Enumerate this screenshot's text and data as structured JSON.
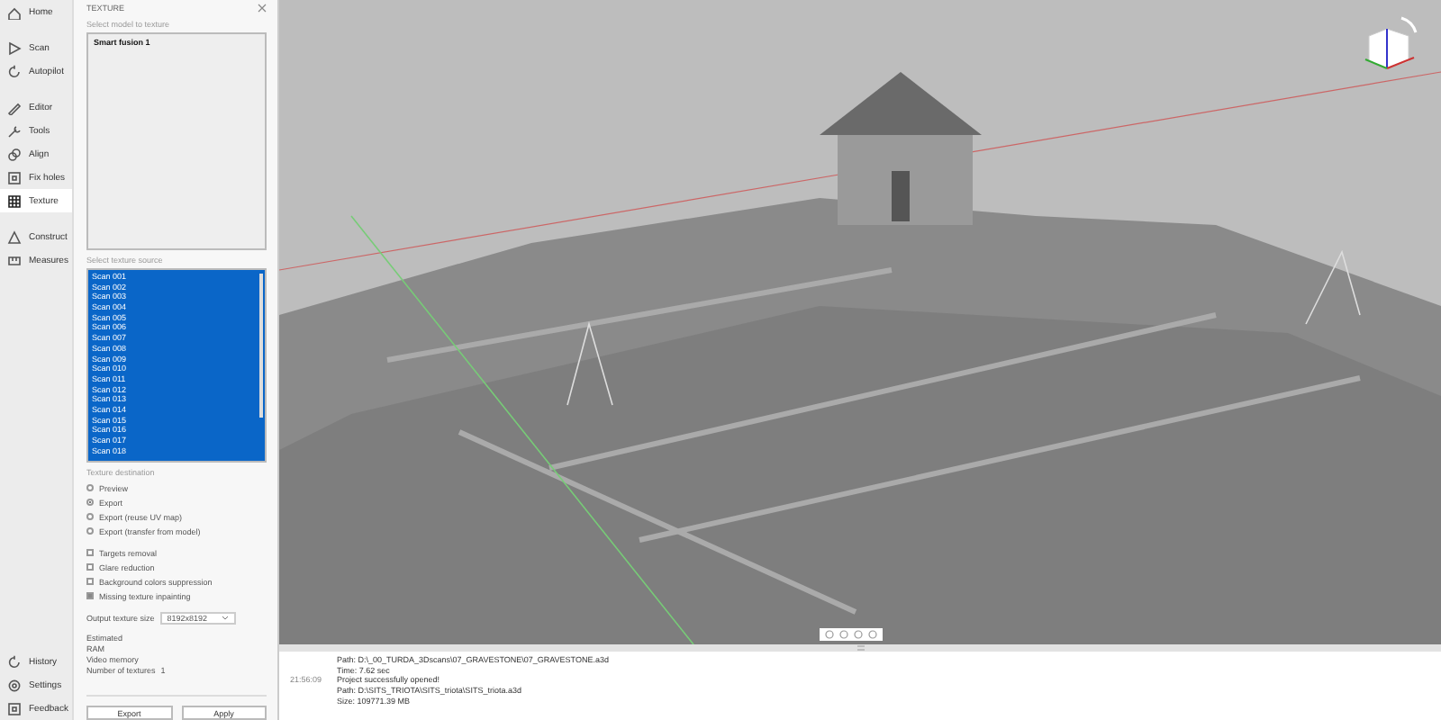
{
  "nav": {
    "top": [
      {
        "label": "Home",
        "kind": "home",
        "selected": false
      },
      {
        "label": "Scan",
        "kind": "play",
        "selected": false
      },
      {
        "label": "Autopilot",
        "kind": "cycle",
        "selected": false
      },
      {
        "label": "Editor",
        "kind": "pen",
        "selected": false
      },
      {
        "label": "Tools",
        "kind": "tool",
        "selected": false
      },
      {
        "label": "Align",
        "kind": "align",
        "selected": false
      },
      {
        "label": "Fix holes",
        "kind": "square",
        "selected": false
      },
      {
        "label": "Texture",
        "kind": "grid",
        "selected": true
      },
      {
        "label": "Construct",
        "kind": "triangle",
        "selected": false
      },
      {
        "label": "Measures",
        "kind": "ruler",
        "selected": false
      }
    ],
    "bottom": [
      {
        "label": "History",
        "kind": "cycle",
        "selected": false
      },
      {
        "label": "Settings",
        "kind": "gear",
        "selected": false
      },
      {
        "label": "Feedback",
        "kind": "square",
        "selected": false
      }
    ]
  },
  "panel": {
    "title": "TEXTURE",
    "model_label": "Select model to texture",
    "models": [
      {
        "label": "Smart fusion 1",
        "selected": false
      }
    ],
    "source_label": "Select texture source",
    "sources": [
      {
        "label": "Scan 001",
        "selected": true
      },
      {
        "label": "Scan 002",
        "selected": true
      },
      {
        "label": "Scan 003",
        "selected": true
      },
      {
        "label": "Scan 004",
        "selected": true
      },
      {
        "label": "Scan 005",
        "selected": true
      },
      {
        "label": "Scan 006",
        "selected": true
      },
      {
        "label": "Scan 007",
        "selected": true
      },
      {
        "label": "Scan 008",
        "selected": true
      },
      {
        "label": "Scan 009",
        "selected": true
      },
      {
        "label": "Scan 010",
        "selected": true
      },
      {
        "label": "Scan 011",
        "selected": true
      },
      {
        "label": "Scan 012",
        "selected": true
      },
      {
        "label": "Scan 013",
        "selected": true
      },
      {
        "label": "Scan 014",
        "selected": true
      },
      {
        "label": "Scan 015",
        "selected": true
      },
      {
        "label": "Scan 016",
        "selected": true
      },
      {
        "label": "Scan 017",
        "selected": true
      },
      {
        "label": "Scan 018",
        "selected": true
      }
    ],
    "destination_label": "Texture destination",
    "destinations": [
      {
        "label": "Preview",
        "selected": false
      },
      {
        "label": "Export",
        "selected": true
      },
      {
        "label": "Export (reuse UV map)",
        "selected": false
      },
      {
        "label": "Export (transfer from model)",
        "selected": false
      }
    ],
    "options": [
      {
        "label": "Targets removal",
        "checked": false
      },
      {
        "label": "Glare reduction",
        "checked": false
      },
      {
        "label": "Background colors suppression",
        "checked": false
      },
      {
        "label": "Missing texture inpainting",
        "checked": true
      }
    ],
    "size_label": "Output texture size",
    "size_value": "8192x8192",
    "estimates": [
      "Estimated",
      "RAM",
      "Video memory"
    ],
    "textures_label": "Number of textures",
    "textures_value": "1",
    "buttons": [
      "Export",
      "Apply"
    ]
  },
  "log": [
    {
      "lines": [
        "Path: D:\\_00_TURDA_3Dscans\\07_GRAVESTONE\\07_GRAVESTONE.a3d",
        "Time: 7.62 sec"
      ]
    },
    {
      "time": "21:56:09",
      "lines": [
        "Project successfully opened!",
        "Path: D:\\SITS_TRIOTA\\SITS_triota\\SITS_triota.a3d",
        "Size: 109771.39 MB"
      ]
    }
  ]
}
